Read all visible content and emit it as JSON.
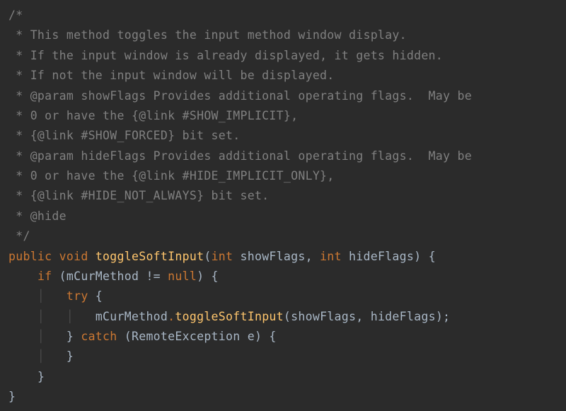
{
  "code": {
    "comment": {
      "open": "/*",
      "l1": " * This method toggles the input method window display.",
      "l2": " * If the input window is already displayed, it gets hidden.",
      "l3": " * If not the input window will be displayed.",
      "l4": " * @param showFlags Provides additional operating flags.  May be",
      "l5": " * 0 or have the {@link #SHOW_IMPLICIT},",
      "l6": " * {@link #SHOW_FORCED} bit set.",
      "l7": " * @param hideFlags Provides additional operating flags.  May be",
      "l8": " * 0 or have the {@link #HIDE_IMPLICIT_ONLY},",
      "l9": " * {@link #HIDE_NOT_ALWAYS} bit set.",
      "l10": " * @hide",
      "close": " */"
    },
    "decl": {
      "kw_public": "public",
      "kw_void": "void",
      "method_name": "toggleSoftInput",
      "paren_open": "(",
      "kw_int1": "int",
      "param1": " showFlags, ",
      "kw_int2": "int",
      "param2": " hideFlags) {"
    },
    "if_line": {
      "indent": "    ",
      "kw_if": "if",
      "rest": " (mCurMethod != ",
      "kw_null": "null",
      "rest2": ") {"
    },
    "try_line": {
      "indent": "        ",
      "kw_try": "try",
      "rest": " {"
    },
    "call_line": {
      "indent": "            ",
      "obj": "mCurMethod",
      "dot": ".",
      "method": "toggleSoftInput",
      "args": "(showFlags, hideFlags);"
    },
    "catch_line": {
      "indent": "        ",
      "close_try": "} ",
      "kw_catch": "catch",
      "rest": " (RemoteException e) {"
    },
    "catch_close": {
      "indent": "        ",
      "brace": "}"
    },
    "if_close": {
      "indent": "    ",
      "brace": "}"
    },
    "method_close": "}"
  }
}
